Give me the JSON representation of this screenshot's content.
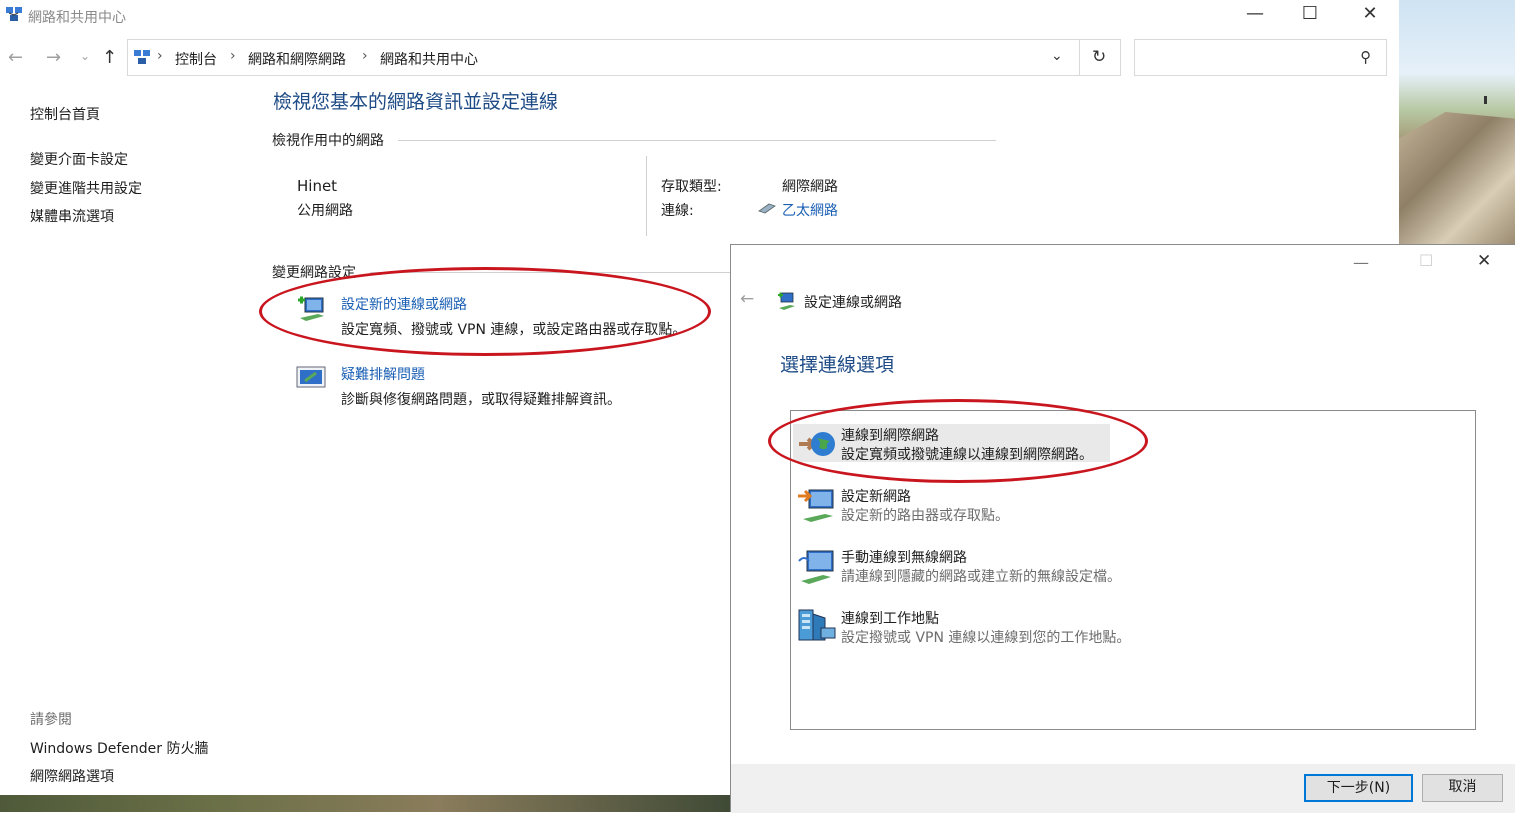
{
  "window": {
    "title": "網路和共用中心",
    "controls": {
      "minimize": "—",
      "maximize": "☐",
      "close": "✕"
    }
  },
  "address": {
    "breadcrumbs": [
      "控制台",
      "網路和網際網路",
      "網路和共用中心"
    ],
    "search_placeholder": ""
  },
  "sidebar": {
    "home": "控制台首頁",
    "items": [
      "變更介面卡設定",
      "變更進階共用設定",
      "媒體串流選項"
    ],
    "see_also_label": "請參閱",
    "see_also": [
      "Windows Defender 防火牆",
      "網際網路選項"
    ]
  },
  "main": {
    "title": "檢視您基本的網路資訊並設定連線",
    "active_networks_label": "檢視作用中的網路",
    "network_name": "Hinet",
    "network_type": "公用網路",
    "access_type_label": "存取類型:",
    "access_type_value": "網際網路",
    "connections_label": "連線:",
    "connections_value": "乙太網路",
    "change_settings_label": "變更網路設定",
    "tasks": [
      {
        "title": "設定新的連線或網路",
        "desc": "設定寬頻、撥號或 VPN 連線，或設定路由器或存取點。"
      },
      {
        "title": "疑難排解問題",
        "desc": "診斷與修復網路問題，或取得疑難排解資訊。"
      }
    ]
  },
  "dialog": {
    "title": "設定連線或網路",
    "heading": "選擇連線選項",
    "options": [
      {
        "title": "連線到網際網路",
        "desc": "設定寬頻或撥號連線以連線到網際網路。"
      },
      {
        "title": "設定新網路",
        "desc": "設定新的路由器或存取點。"
      },
      {
        "title": "手動連線到無線網路",
        "desc": "請連線到隱藏的網路或建立新的無線設定檔。"
      },
      {
        "title": "連線到工作地點",
        "desc": "設定撥號或 VPN 連線以連線到您的工作地點。"
      }
    ],
    "next_button": "下一步(N)",
    "cancel_button": "取消"
  },
  "colors": {
    "link": "#1a5fb4",
    "heading": "#1e4b86",
    "highlight": "#c9151e",
    "accent": "#0078d7"
  }
}
